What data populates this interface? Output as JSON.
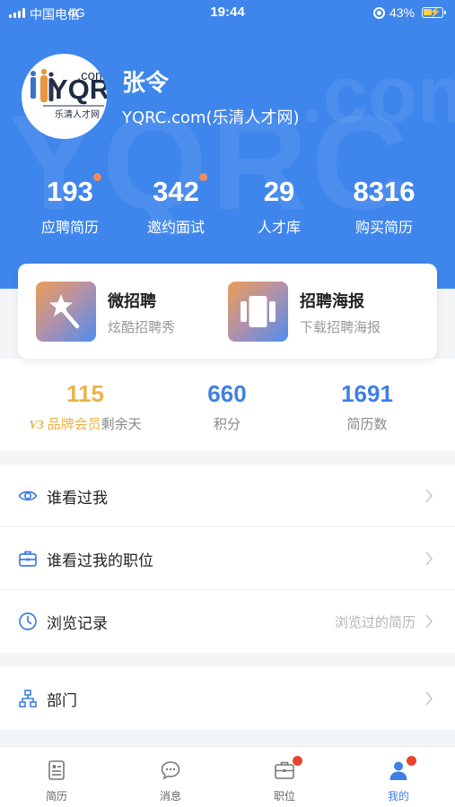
{
  "status_bar": {
    "carrier": "中国电信",
    "network": "4G",
    "time": "19:44",
    "battery_percent": "43%"
  },
  "profile": {
    "name": "张令",
    "company": "YQRC.com(乐清人才网)",
    "logo_text": "YQRC",
    "logo_com": ".com",
    "logo_caption": "乐清人才网"
  },
  "stats": [
    {
      "value": "193",
      "label": "应聘简历",
      "has_dot": true
    },
    {
      "value": "342",
      "label": "邀约面试",
      "has_dot": true
    },
    {
      "value": "29",
      "label": "人才库",
      "has_dot": false
    },
    {
      "value": "8316",
      "label": "购买简历",
      "has_dot": false
    }
  ],
  "features": [
    {
      "title": "微招聘",
      "subtitle": "炫酷招聘秀",
      "icon": "magic-wand-icon"
    },
    {
      "title": "招聘海报",
      "subtitle": "下载招聘海报",
      "icon": "poster-icon"
    }
  ],
  "membership": {
    "days_value": "115",
    "vip_badge": "V3",
    "member_type": "品牌会员",
    "days_label": "剩余天",
    "points_value": "660",
    "points_label": "积分",
    "resumes_value": "1691",
    "resumes_label": "简历数"
  },
  "menu_group_1": [
    {
      "label": "谁看过我",
      "hint": "",
      "icon": "eye-icon"
    },
    {
      "label": "谁看过我的职位",
      "hint": "",
      "icon": "briefcase-icon"
    },
    {
      "label": "浏览记录",
      "hint": "浏览过的简历",
      "icon": "clock-icon"
    }
  ],
  "menu_group_2": [
    {
      "label": "部门",
      "hint": "",
      "icon": "org-chart-icon"
    }
  ],
  "tabbar": [
    {
      "label": "简历",
      "icon": "resume-icon",
      "active": false,
      "badge": false
    },
    {
      "label": "消息",
      "icon": "message-icon",
      "active": false,
      "badge": false
    },
    {
      "label": "职位",
      "icon": "job-icon",
      "active": false,
      "badge": true
    },
    {
      "label": "我的",
      "icon": "user-icon",
      "active": true,
      "badge": true
    }
  ],
  "colors": {
    "header_blue": "#3f86ec",
    "accent_blue": "#3f7fe4",
    "gold": "#e8b44a",
    "badge_red": "#e8442e",
    "stat_dot": "#f08a5d"
  }
}
